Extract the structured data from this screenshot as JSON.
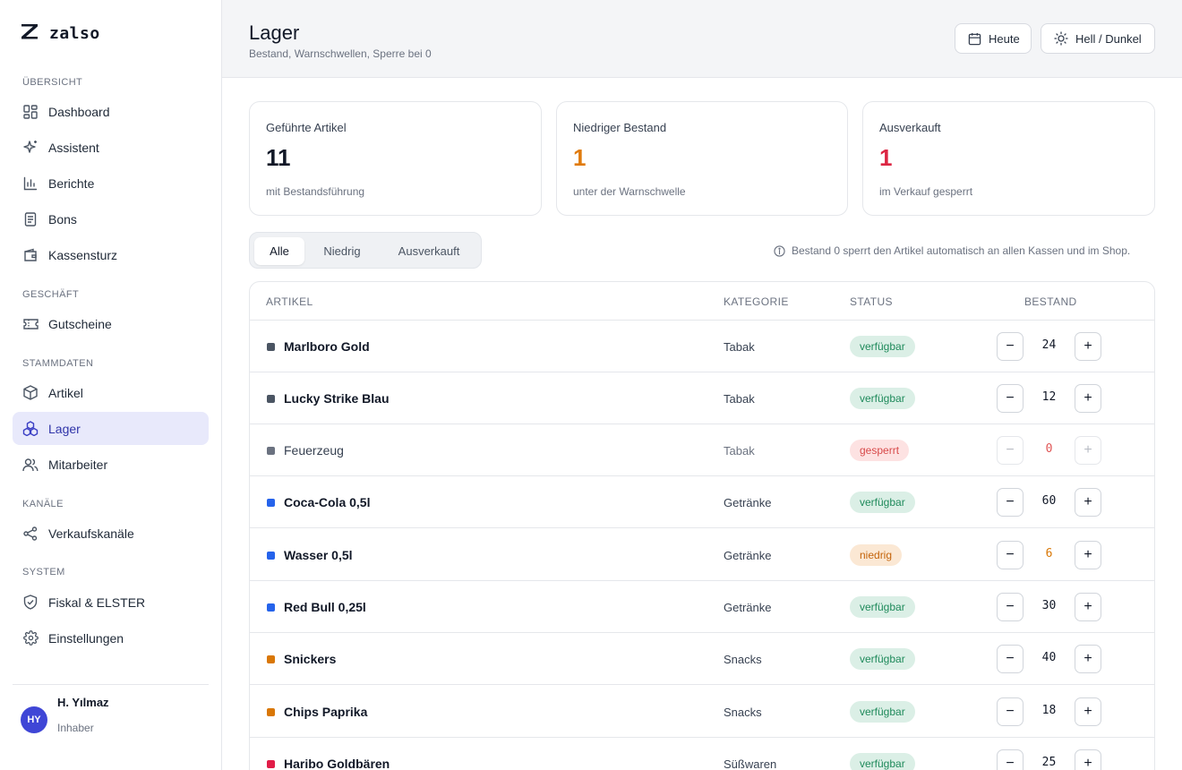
{
  "brand": {
    "name": "zalso"
  },
  "sidebar": {
    "sections": [
      {
        "label": "ÜBERSICHT",
        "items": [
          {
            "label": "Dashboard",
            "icon": "dashboard-icon"
          },
          {
            "label": "Assistent",
            "icon": "sparkle-icon"
          },
          {
            "label": "Berichte",
            "icon": "bar-chart-icon"
          },
          {
            "label": "Bons",
            "icon": "receipt-icon"
          },
          {
            "label": "Kassensturz",
            "icon": "wallet-icon"
          }
        ]
      },
      {
        "label": "GESCHÄFT",
        "items": [
          {
            "label": "Gutscheine",
            "icon": "ticket-icon"
          }
        ]
      },
      {
        "label": "STAMMDATEN",
        "items": [
          {
            "label": "Artikel",
            "icon": "box-icon"
          },
          {
            "label": "Lager",
            "icon": "boxes-icon",
            "active": true
          },
          {
            "label": "Mitarbeiter",
            "icon": "users-icon"
          }
        ]
      },
      {
        "label": "KANÄLE",
        "items": [
          {
            "label": "Verkaufskanäle",
            "icon": "share-icon"
          }
        ]
      },
      {
        "label": "SYSTEM",
        "items": [
          {
            "label": "Fiskal & ELSTER",
            "icon": "shield-icon"
          },
          {
            "label": "Einstellungen",
            "icon": "gear-icon"
          }
        ]
      }
    ],
    "user": {
      "initials": "HY",
      "name": "H. Yılmaz",
      "role": "Inhaber"
    }
  },
  "header": {
    "title": "Lager",
    "subtitle": "Bestand, Warnschwellen, Sperre bei 0",
    "today_label": "Heute",
    "theme_label": "Hell / Dunkel"
  },
  "stats": [
    {
      "title": "Geführte Artikel",
      "value": "11",
      "caption": "mit Bestandsführung",
      "color": "#111827"
    },
    {
      "title": "Niedriger Bestand",
      "value": "1",
      "caption": "unter der Warnschwelle",
      "color": "#e07b0c"
    },
    {
      "title": "Ausverkauft",
      "value": "1",
      "caption": "im Verkauf gesperrt",
      "color": "#dc2643"
    }
  ],
  "filter": {
    "tabs": [
      "Alle",
      "Niedrig",
      "Ausverkauft"
    ],
    "active": "Alle"
  },
  "info_note": "Bestand 0 sperrt den Artikel automatisch an allen Kassen und im Shop.",
  "table": {
    "columns": [
      "ARTIKEL",
      "KATEGORIE",
      "STATUS",
      "BESTAND"
    ],
    "rows": [
      {
        "name": "Marlboro Gold",
        "category": "Tabak",
        "status": "verfügbar",
        "status_type": "ok",
        "stock": "24",
        "color": "#4b5563"
      },
      {
        "name": "Lucky Strike Blau",
        "category": "Tabak",
        "status": "verfügbar",
        "status_type": "ok",
        "stock": "12",
        "color": "#4b5563"
      },
      {
        "name": "Feuerzeug",
        "category": "Tabak",
        "status": "gesperrt",
        "status_type": "locked",
        "stock": "0",
        "color": "#6b7280"
      },
      {
        "name": "Coca-Cola 0,5l",
        "category": "Getränke",
        "status": "verfügbar",
        "status_type": "ok",
        "stock": "60",
        "color": "#2563eb"
      },
      {
        "name": "Wasser 0,5l",
        "category": "Getränke",
        "status": "niedrig",
        "status_type": "low",
        "stock": "6",
        "color": "#2563eb"
      },
      {
        "name": "Red Bull 0,25l",
        "category": "Getränke",
        "status": "verfügbar",
        "status_type": "ok",
        "stock": "30",
        "color": "#2563eb"
      },
      {
        "name": "Snickers",
        "category": "Snacks",
        "status": "verfügbar",
        "status_type": "ok",
        "stock": "40",
        "color": "#d97706"
      },
      {
        "name": "Chips Paprika",
        "category": "Snacks",
        "status": "verfügbar",
        "status_type": "ok",
        "stock": "18",
        "color": "#d97706"
      },
      {
        "name": "Haribo Goldbären",
        "category": "Süßwaren",
        "status": "verfügbar",
        "status_type": "ok",
        "stock": "25",
        "color": "#e11d48"
      }
    ],
    "stock_colors": {
      "ok": "#111827",
      "low": "#d97706",
      "locked": "#e05555"
    }
  }
}
